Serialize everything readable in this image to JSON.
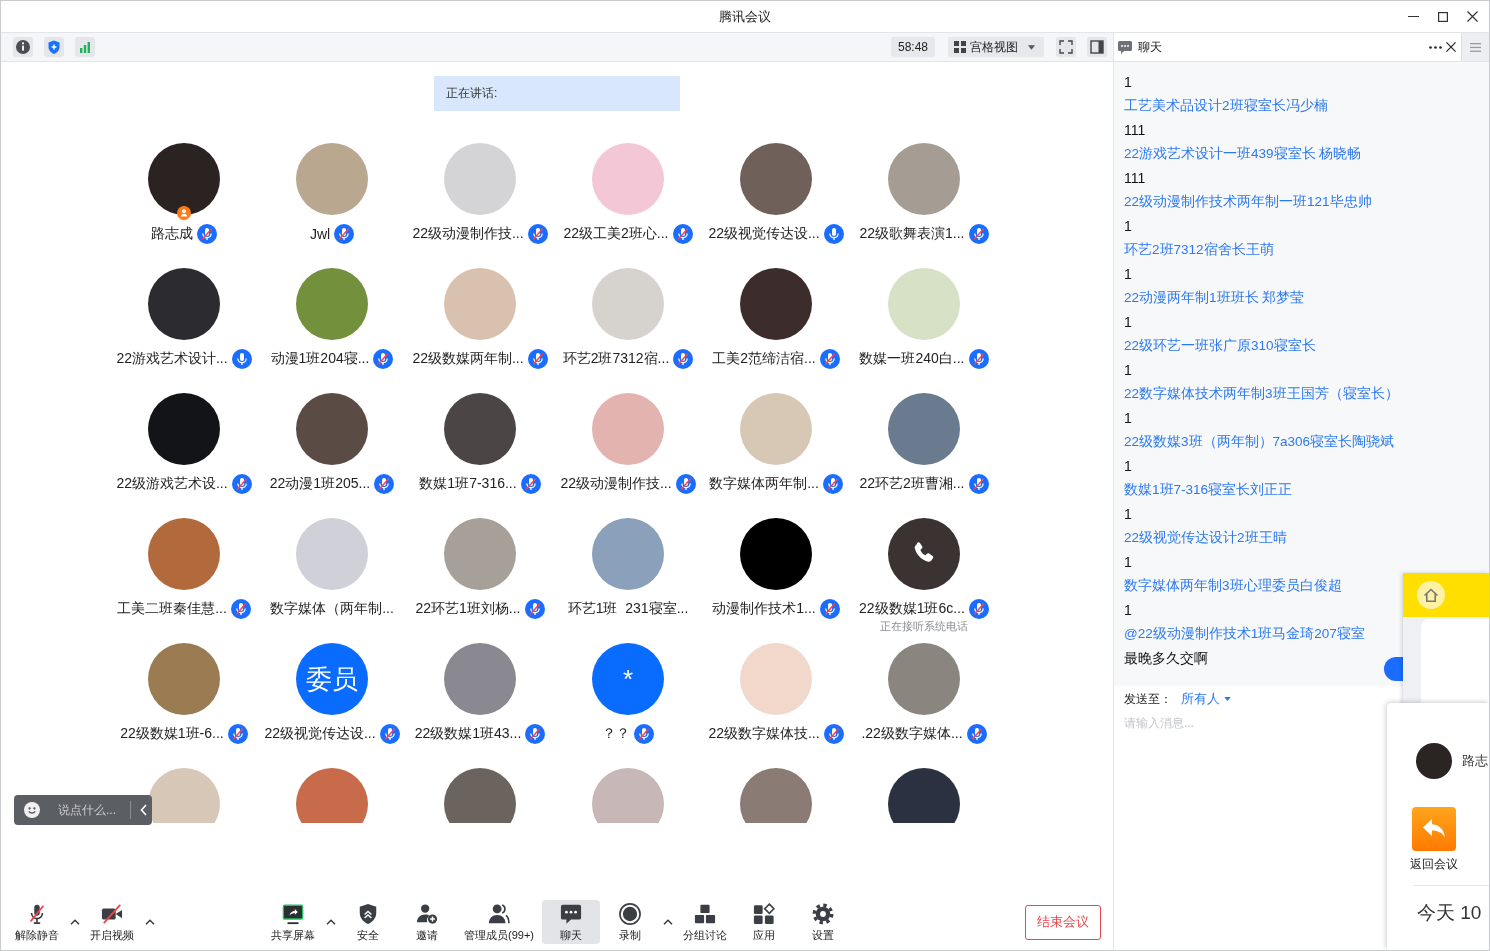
{
  "window": {
    "title": "腾讯会议"
  },
  "meeting_bar": {
    "timer": "58:48",
    "view_mode": "宫格视图"
  },
  "speaking": {
    "label": "正在讲话:"
  },
  "participants": [
    {
      "name": "路志成",
      "avatar": {
        "kind": "photo"
      },
      "audio": {
        "muted": true
      },
      "host": true,
      "on_call": false
    },
    {
      "name": "Jwl",
      "avatar": {
        "kind": "photo"
      },
      "audio": {
        "muted": true
      },
      "host": false,
      "on_call": false
    },
    {
      "name": "22级动漫制作技...",
      "avatar": {
        "kind": "photo"
      },
      "audio": {
        "muted": true
      },
      "host": false,
      "on_call": false
    },
    {
      "name": "22级工美2班心...",
      "avatar": {
        "kind": "photo"
      },
      "audio": {
        "muted": true
      },
      "host": false,
      "on_call": false
    },
    {
      "name": "22级视觉传达设...",
      "avatar": {
        "kind": "photo"
      },
      "audio": {
        "muted": false
      },
      "host": false,
      "on_call": false
    },
    {
      "name": "22级歌舞表演1...",
      "avatar": {
        "kind": "photo"
      },
      "audio": {
        "muted": true
      },
      "host": false,
      "on_call": false
    },
    {
      "name": "22游戏艺术设计...",
      "avatar": {
        "kind": "photo"
      },
      "audio": {
        "muted": false
      },
      "host": false,
      "on_call": false
    },
    {
      "name": "动漫1班204寝...",
      "avatar": {
        "kind": "photo"
      },
      "audio": {
        "muted": true
      },
      "host": false,
      "on_call": false
    },
    {
      "name": "22级数媒两年制...",
      "avatar": {
        "kind": "photo"
      },
      "audio": {
        "muted": true
      },
      "host": false,
      "on_call": false
    },
    {
      "name": "环艺2班7312宿...",
      "avatar": {
        "kind": "photo"
      },
      "audio": {
        "muted": true
      },
      "host": false,
      "on_call": false
    },
    {
      "name": "工美2范缔洁宿...",
      "avatar": {
        "kind": "photo"
      },
      "audio": {
        "muted": true
      },
      "host": false,
      "on_call": false
    },
    {
      "name": "数媒一班240白...",
      "avatar": {
        "kind": "photo"
      },
      "audio": {
        "muted": true
      },
      "host": false,
      "on_call": false
    },
    {
      "name": "22级游戏艺术设...",
      "avatar": {
        "kind": "photo"
      },
      "audio": {
        "muted": true
      },
      "host": false,
      "on_call": false
    },
    {
      "name": "22动漫1班205...",
      "avatar": {
        "kind": "photo"
      },
      "audio": {
        "muted": true
      },
      "host": false,
      "on_call": false
    },
    {
      "name": "数媒1班7-316...",
      "avatar": {
        "kind": "photo"
      },
      "audio": {
        "muted": true
      },
      "host": false,
      "on_call": false
    },
    {
      "name": "22级动漫制作技...",
      "avatar": {
        "kind": "photo"
      },
      "audio": {
        "muted": true
      },
      "host": false,
      "on_call": false
    },
    {
      "name": "数字媒体两年制...",
      "avatar": {
        "kind": "photo"
      },
      "audio": {
        "muted": true
      },
      "host": false,
      "on_call": false
    },
    {
      "name": "22环艺2班曹湘...",
      "avatar": {
        "kind": "photo"
      },
      "audio": {
        "muted": true
      },
      "host": false,
      "on_call": false
    },
    {
      "name": "工美二班秦佳慧...",
      "avatar": {
        "kind": "photo"
      },
      "audio": {
        "muted": true
      },
      "host": false,
      "on_call": false
    },
    {
      "name": "数字媒体（两年制...",
      "avatar": {
        "kind": "photo"
      },
      "host": false,
      "on_call": false
    },
    {
      "name": "22环艺1班刘杨...",
      "avatar": {
        "kind": "photo"
      },
      "audio": {
        "muted": true
      },
      "host": false,
      "on_call": false
    },
    {
      "name": "环艺1班  231寝室...",
      "avatar": {
        "kind": "photo"
      },
      "host": false,
      "on_call": false
    },
    {
      "name": "动漫制作技术1...",
      "avatar": {
        "kind": "photo"
      },
      "audio": {
        "muted": true
      },
      "host": false,
      "on_call": false
    },
    {
      "name": "22级数媒1班6c...",
      "avatar": {
        "kind": "photo"
      },
      "audio": {
        "muted": true
      },
      "host": false,
      "on_call": true,
      "status": "正在接听系统电话"
    },
    {
      "name": "22级数媒1班-6...",
      "avatar": {
        "kind": "photo"
      },
      "audio": {
        "muted": true
      },
      "host": false,
      "on_call": false
    },
    {
      "name": "22级视觉传达设...",
      "avatar": {
        "kind": "text",
        "text": "委员"
      },
      "audio": {
        "muted": true
      },
      "host": false,
      "on_call": false
    },
    {
      "name": "22级数媒1班43...",
      "avatar": {
        "kind": "photo"
      },
      "audio": {
        "muted": true
      },
      "host": false,
      "on_call": false
    },
    {
      "name": "？？",
      "avatar": {
        "kind": "text",
        "text": "*"
      },
      "audio": {
        "muted": true
      },
      "host": false,
      "on_call": false
    },
    {
      "name": "22级数字媒体技...",
      "avatar": {
        "kind": "photo"
      },
      "audio": {
        "muted": true
      },
      "host": false,
      "on_call": false
    },
    {
      "name": ".22级数字媒体...",
      "avatar": {
        "kind": "photo"
      },
      "audio": {
        "muted": true
      },
      "host": false,
      "on_call": false
    },
    {
      "avatar": {
        "kind": "photo"
      },
      "host": false,
      "on_call": false
    },
    {
      "avatar": {
        "kind": "photo"
      },
      "host": false,
      "on_call": false
    },
    {
      "avatar": {
        "kind": "photo"
      },
      "host": false,
      "on_call": false
    },
    {
      "avatar": {
        "kind": "photo"
      },
      "host": false,
      "on_call": false
    },
    {
      "avatar": {
        "kind": "photo"
      },
      "host": false,
      "on_call": false
    },
    {
      "avatar": {
        "kind": "photo"
      },
      "host": false,
      "on_call": false
    }
  ],
  "reaction_bar": {
    "placeholder": "说点什么..."
  },
  "toolbar": {
    "left": [
      {
        "kind": "mute",
        "label": "解除静音",
        "caret": true,
        "selected": false
      },
      {
        "kind": "video",
        "label": "开启视频",
        "caret": true,
        "selected": false
      }
    ],
    "center": [
      {
        "kind": "share",
        "label": "共享屏幕",
        "caret": true,
        "selected": false
      },
      {
        "kind": "security",
        "label": "安全",
        "caret": false,
        "selected": false
      },
      {
        "kind": "invite",
        "label": "邀请",
        "caret": false,
        "selected": false
      },
      {
        "kind": "members",
        "label": "管理成员(99+)",
        "caret": false,
        "selected": false
      },
      {
        "kind": "chat",
        "label": "聊天",
        "caret": false,
        "selected": true
      },
      {
        "kind": "record",
        "label": "录制",
        "caret": true,
        "selected": false
      },
      {
        "kind": "breakout",
        "label": "分组讨论",
        "caret": false,
        "selected": false
      },
      {
        "kind": "apps",
        "label": "应用",
        "caret": false,
        "selected": false
      },
      {
        "kind": "settings",
        "label": "设置",
        "caret": false,
        "selected": false
      }
    ],
    "end_button": {
      "label": "结束会议"
    }
  },
  "chat": {
    "title": "聊天",
    "lines": [
      {
        "kind": "message",
        "text": "1"
      },
      {
        "kind": "name",
        "text": "工艺美术品设计2班寝室长冯少楠"
      },
      {
        "kind": "message",
        "text": "111"
      },
      {
        "kind": "name",
        "text": "22游戏艺术设计一班439寝室长 杨晓畅"
      },
      {
        "kind": "message",
        "text": "111"
      },
      {
        "kind": "name",
        "text": "22级动漫制作技术两年制一班121毕忠帅"
      },
      {
        "kind": "message",
        "text": "1"
      },
      {
        "kind": "name",
        "text": "环艺2班7312宿舍长王萌"
      },
      {
        "kind": "message",
        "text": "1"
      },
      {
        "kind": "name",
        "text": "22动漫两年制1班班长 郑梦莹"
      },
      {
        "kind": "message",
        "text": "1"
      },
      {
        "kind": "name",
        "text": "22级环艺一班张广原310寝室长"
      },
      {
        "kind": "message",
        "text": "1"
      },
      {
        "kind": "name",
        "text": "22数字媒体技术两年制3班王国芳（寝室长）"
      },
      {
        "kind": "message",
        "text": "1"
      },
      {
        "kind": "name",
        "text": "22级数媒3班（两年制）7a306寝室长陶骁斌"
      },
      {
        "kind": "message",
        "text": "1"
      },
      {
        "kind": "name",
        "text": "数媒1班7-316寝室长刘正正"
      },
      {
        "kind": "message",
        "text": "1"
      },
      {
        "kind": "name",
        "text": "22级视觉传达设计2班王晴"
      },
      {
        "kind": "message",
        "text": "1"
      },
      {
        "kind": "name",
        "text": "数字媒体两年制3班心理委员白俊超"
      },
      {
        "kind": "message",
        "text": "1"
      },
      {
        "kind": "mention",
        "text": "@22级动漫制作技术1班马金琦207寝室"
      },
      {
        "kind": "message",
        "text": "最晚多久交啊"
      }
    ],
    "send_to": {
      "label": "发送至：",
      "target": "所有人"
    },
    "input": {
      "placeholder": "请输入消息..."
    }
  },
  "return_popup": {
    "host_name": "路志",
    "button": "返回会议",
    "date": "今天 10"
  }
}
